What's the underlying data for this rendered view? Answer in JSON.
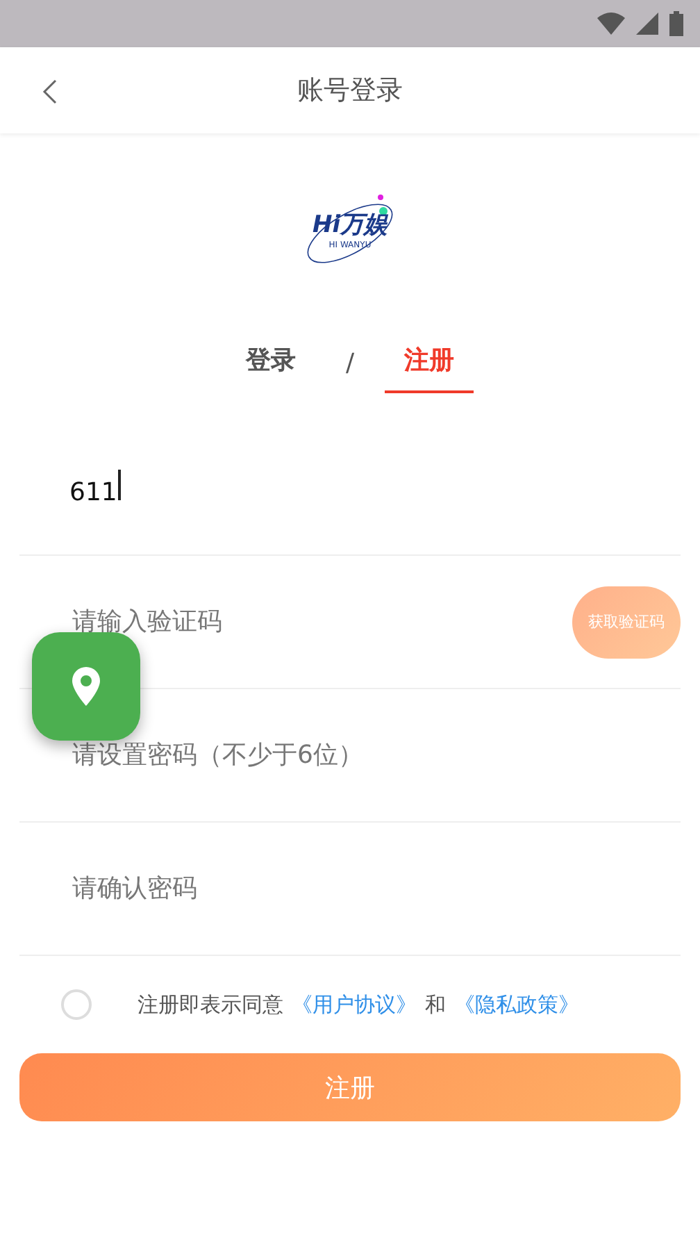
{
  "app_bar": {
    "title": "账号登录"
  },
  "logo": {
    "title": "Hi万娱",
    "subtitle": "HI WANYU"
  },
  "tabs": [
    {
      "label": "登录",
      "selected": false
    },
    {
      "label": "注册",
      "selected": true
    }
  ],
  "tab_separator": "/",
  "fields": [
    {
      "kind": "phone",
      "value": "611",
      "focused": true
    },
    {
      "kind": "code",
      "placeholder": "请输入验证码",
      "action": "获取验证码"
    },
    {
      "kind": "password",
      "placeholder": "请设置密码（不少于6位）"
    },
    {
      "kind": "password",
      "placeholder": "请确认密码"
    }
  ],
  "agreement": {
    "checked": false,
    "text": "注册即表示同意",
    "link_1": "《用户协议》",
    "joiner": "和",
    "link_2": "《隐私政策》"
  },
  "submit": "注册"
}
